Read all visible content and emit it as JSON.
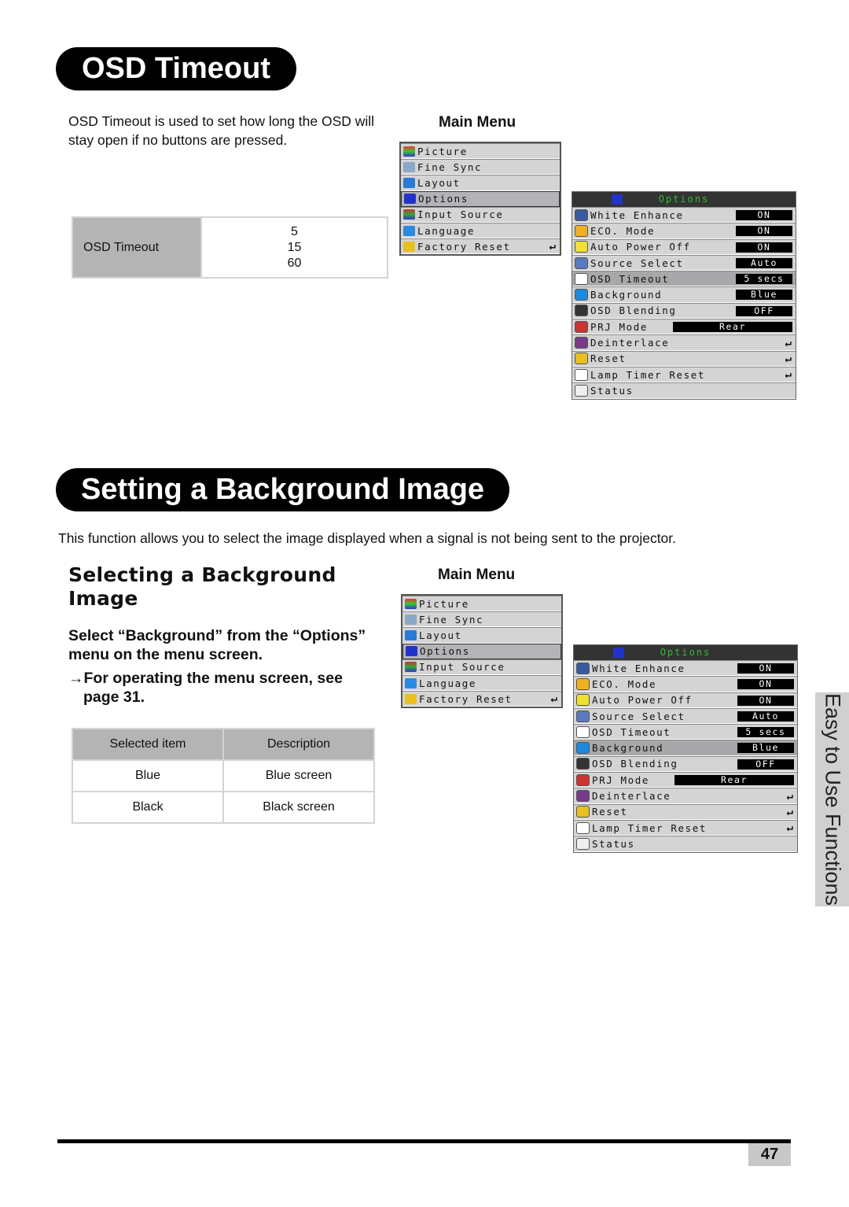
{
  "section1": {
    "title": "OSD Timeout",
    "intro": "OSD Timeout is used to set how long the OSD will stay open if no buttons are pressed.",
    "table": {
      "label": "OSD Timeout",
      "values": [
        "5",
        "15",
        "60"
      ]
    },
    "main_menu_label": "Main Menu"
  },
  "section2": {
    "title": "Setting a Background Image",
    "intro": "This function allows you to select the image displayed when a signal is not being sent to the projector.",
    "subheading": "Selecting a Background Image",
    "instruction": "Select “Background” from the “Options” menu on the menu screen.",
    "reference_line1": "→For operating the menu screen, see",
    "reference_line2": "page 31.",
    "main_menu_label": "Main Menu",
    "table": {
      "headers": [
        "Selected item",
        "Description"
      ],
      "rows": [
        [
          "Blue",
          "Blue screen"
        ],
        [
          "Black",
          "Black screen"
        ]
      ]
    }
  },
  "main_menu": {
    "items": [
      {
        "label": "Picture",
        "icon": "picture-icon"
      },
      {
        "label": "Fine Sync",
        "icon": "fine-sync-icon"
      },
      {
        "label": "Layout",
        "icon": "layout-icon"
      },
      {
        "label": "Options",
        "icon": "options-icon",
        "selected": true
      },
      {
        "label": "Input Source",
        "icon": "input-source-icon"
      },
      {
        "label": "Language",
        "icon": "language-icon"
      },
      {
        "label": "Factory Reset",
        "icon": "factory-reset-icon",
        "enter": "↵"
      }
    ]
  },
  "options_menu": {
    "title": "Options",
    "items": [
      {
        "label": "White Enhance",
        "value": "ON"
      },
      {
        "label": "ECO. Mode",
        "value": "ON"
      },
      {
        "label": "Auto Power Off",
        "value": "ON"
      },
      {
        "label": "Source Select",
        "value": "Auto"
      },
      {
        "label": "OSD Timeout",
        "value": "5 secs"
      },
      {
        "label": "Background",
        "value": "Blue"
      },
      {
        "label": "OSD Blending",
        "value": "OFF"
      },
      {
        "label": "PRJ Mode",
        "value": "Rear"
      },
      {
        "label": "Deinterlace",
        "enter": "↵"
      },
      {
        "label": "Reset",
        "enter": "↵"
      },
      {
        "label": "Lamp Timer Reset",
        "enter": "↵"
      },
      {
        "label": "Status"
      }
    ],
    "selected_in_first": "OSD Timeout",
    "selected_in_second": "Background"
  },
  "side_tab": "Easy to Use Functions",
  "page_number": "47",
  "colors": {
    "header_black": "#000000",
    "table_header_gray": "#b4b4b4",
    "osd_title_green": "#33bb33",
    "side_tab_gray": "#d0d0d0"
  }
}
